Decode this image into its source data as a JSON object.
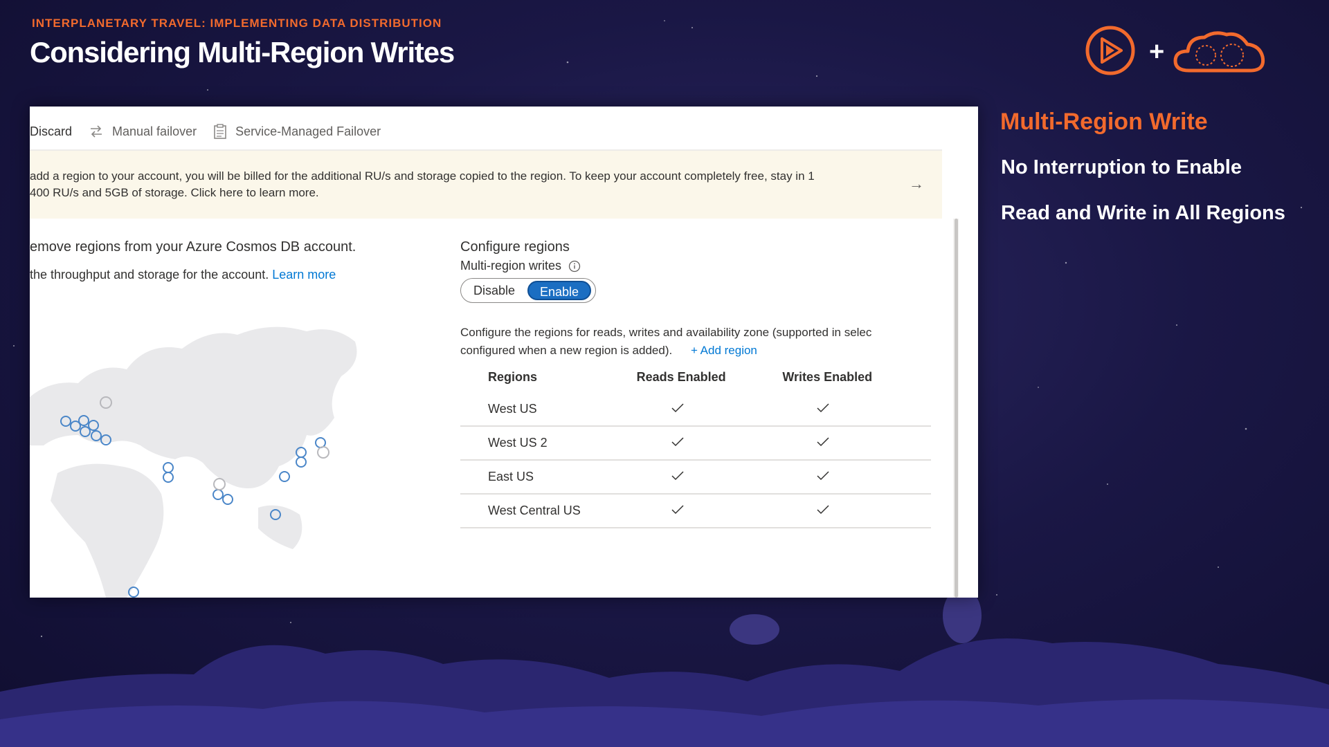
{
  "slide": {
    "kicker": "INTERPLANETARY TRAVEL: IMPLEMENTING DATA DISTRIBUTION",
    "title": "Considering Multi-Region Writes",
    "plus": "+"
  },
  "side_panel": {
    "heading": "Multi-Region Write",
    "points": [
      "No Interruption to Enable",
      "Read and Write in All Regions"
    ]
  },
  "toolbar": {
    "discard": "Discard",
    "manual_failover": "Manual failover",
    "service_managed_failover": "Service-Managed Failover"
  },
  "notice": {
    "line1": "add a region to your account, you will be billed for the additional RU/s and storage copied to the region. To keep your account completely free, stay in 1",
    "line2": "400 RU/s and 5GB of storage.   Click here to learn more."
  },
  "intro": {
    "line1": "emove regions from your Azure Cosmos DB account.",
    "line2": "the throughput and storage for the account.",
    "learn_more": "Learn more"
  },
  "configure": {
    "title": "Configure regions",
    "multi_region_label": "Multi-region writes",
    "toggle_off": "Disable",
    "toggle_on": "Enable",
    "selected": "Enable",
    "desc_line1": "Configure the regions for reads, writes and availability zone (supported in selec",
    "desc_line2": "configured when a new region is added).",
    "add_region": "+ Add region"
  },
  "table": {
    "headers": [
      "Regions",
      "Reads Enabled",
      "Writes Enabled"
    ],
    "rows": [
      {
        "region": "West US",
        "reads": true,
        "writes": true
      },
      {
        "region": "West US 2",
        "reads": true,
        "writes": true
      },
      {
        "region": "East US",
        "reads": true,
        "writes": true
      },
      {
        "region": "West Central US",
        "reads": true,
        "writes": true
      }
    ]
  },
  "colors": {
    "accent": "#f26a2d",
    "link": "#0078d4",
    "toggle_on": "#1b6ec2",
    "background": "#1a1745"
  }
}
